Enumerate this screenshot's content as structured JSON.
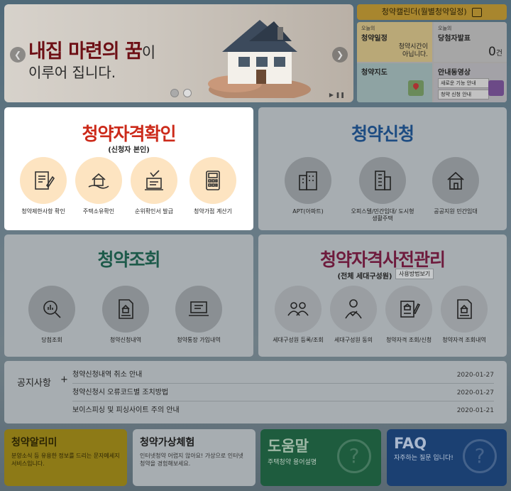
{
  "banner": {
    "headline_bold": "내집 마련의 꿈",
    "headline_rest": "이",
    "subline": "이루어 집니다."
  },
  "calendar_bar": {
    "label": "청약캘린더(월별청약일정)"
  },
  "widget": {
    "schedule": {
      "small": "오늘의",
      "title": "청약일정",
      "note_line1": "청약시간이",
      "note_line2": "아닙니다."
    },
    "winners": {
      "small": "오늘의",
      "title": "당첨자발표",
      "count": "0",
      "unit": "건"
    },
    "map": {
      "title": "청약지도"
    },
    "guide": {
      "title": "안내동영상",
      "link1": "새로운 기능 안내",
      "link2": "청약 신청 안내"
    }
  },
  "panels": {
    "eligibility": {
      "title": "청약자격확인",
      "subtitle": "(신청자 본인)",
      "items": [
        {
          "label": "청약제한사항 확인",
          "icon": "document-pen-icon"
        },
        {
          "label": "주택소유확인",
          "icon": "house-hand-icon"
        },
        {
          "label": "순위확인서 발급",
          "icon": "certificate-check-icon"
        },
        {
          "label": "청약가점 계산기",
          "icon": "calculator-icon"
        }
      ]
    },
    "apply": {
      "title": "청약신청",
      "items": [
        {
          "label": "APT(아파트)",
          "icon": "apartment-icon"
        },
        {
          "label": "오피스텔/민간임대/ 도시형생활주택",
          "icon": "office-building-icon"
        },
        {
          "label": "공공지원 민간임대",
          "icon": "house-icon"
        }
      ]
    },
    "inquiry": {
      "title": "청약조회",
      "items": [
        {
          "label": "당첨조회",
          "icon": "magnifier-chart-icon"
        },
        {
          "label": "청약신청내역",
          "icon": "document-house-icon"
        },
        {
          "label": "청약통장 가입내역",
          "icon": "laptop-icon"
        }
      ]
    },
    "pre_manage": {
      "title": "청약자격사전관리",
      "subtitle": "(전체 세대구성원)",
      "usage_button": "사용방법보기",
      "items": [
        {
          "label": "세대구성원 등록/조회",
          "icon": "people-icon"
        },
        {
          "label": "세대구성원 동의",
          "icon": "person-check-icon"
        },
        {
          "label": "청약자격 조회/신청",
          "icon": "certificate-pen-icon"
        },
        {
          "label": "청약자격 조회내역",
          "icon": "document-house-icon"
        }
      ]
    }
  },
  "notices": {
    "title": "공지사항",
    "plus": "+",
    "items": [
      {
        "text": "청약신청내역 취소 안내",
        "date": "2020-01-27"
      },
      {
        "text": "청약신청시 오류코드별 조치방법",
        "date": "2020-01-27"
      },
      {
        "text": "보이스피싱 및 피싱사이트 주의 안내",
        "date": "2020-01-21"
      }
    ]
  },
  "tiles": [
    {
      "title": "청약알리미",
      "desc": "분양소식 등 유용한 정보를 드리는 문자메세지 서비스입니다.",
      "bg": "#8d7a17",
      "title_color": "#2b2404",
      "desc_color": "#2b2404"
    },
    {
      "title": "청약가상체험",
      "desc": "인터넷청약 어렵지 않아요! 가상으로 인터넷 청약을 경험해보세요.",
      "bg": "#a7adb1",
      "title_color": "#1b1b1b",
      "desc_color": "#333333"
    },
    {
      "title": "도움말",
      "desc": "주택청약 용어설명",
      "bg": "#1e5c3e",
      "title_color": "#9fb8a6",
      "desc_color": "#b8c9bd"
    },
    {
      "title": "FAQ",
      "desc": "자주하는 질문 입니다!",
      "bg": "#1b4072",
      "title_color": "#a9b8ce",
      "desc_color": "#b9c6d8"
    }
  ],
  "colors": {
    "eligibility_title": "#cc2a1a",
    "apply_title": "#1d4c82",
    "inquiry_title": "#1d5a4a",
    "pre_manage_title": "#6e1b3d"
  }
}
